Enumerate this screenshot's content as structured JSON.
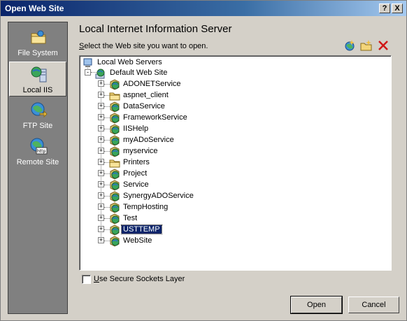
{
  "window": {
    "title": "Open Web Site",
    "help_glyph": "?",
    "close_glyph": "X"
  },
  "nav": {
    "items": [
      {
        "label": "File System",
        "icon": "folder-icon",
        "selected": false
      },
      {
        "label": "Local IIS",
        "icon": "iis-server-icon",
        "selected": true
      },
      {
        "label": "FTP Site",
        "icon": "ftp-globe-icon",
        "selected": false
      },
      {
        "label": "Remote Site",
        "icon": "remote-globe-icon",
        "selected": false
      }
    ]
  },
  "main": {
    "heading": "Local Internet Information Server",
    "subheading_first": "S",
    "subheading_rest": "elect the Web site you want to open.",
    "toolbar": [
      "create-web-application-icon",
      "create-virtual-directory-icon",
      "delete-icon"
    ]
  },
  "tree": {
    "root": "Local Web Servers",
    "site": "Default Web Site",
    "children": [
      {
        "label": "ADONETService",
        "type": "web"
      },
      {
        "label": "aspnet_client",
        "type": "folder"
      },
      {
        "label": "DataService",
        "type": "web"
      },
      {
        "label": "FrameworkService",
        "type": "web"
      },
      {
        "label": "IISHelp",
        "type": "web"
      },
      {
        "label": "myADoService",
        "type": "web"
      },
      {
        "label": "myservice",
        "type": "web"
      },
      {
        "label": "Printers",
        "type": "folder"
      },
      {
        "label": "Project",
        "type": "web"
      },
      {
        "label": "Service",
        "type": "web"
      },
      {
        "label": "SynergyADOService",
        "type": "web"
      },
      {
        "label": "TempHosting",
        "type": "web"
      },
      {
        "label": "Test",
        "type": "web"
      },
      {
        "label": "USTTEMP",
        "type": "web",
        "selected": true
      },
      {
        "label": "WebSite",
        "type": "web"
      }
    ],
    "expand_glyph": "+",
    "collapse_glyph": "-"
  },
  "ssl": {
    "first": "U",
    "rest": "se Secure Sockets Layer",
    "checked": false
  },
  "buttons": {
    "open": "Open",
    "cancel": "Cancel"
  },
  "colors": {
    "selection": "#0a246a",
    "title_start": "#0a246a",
    "title_end": "#a6caf0"
  }
}
